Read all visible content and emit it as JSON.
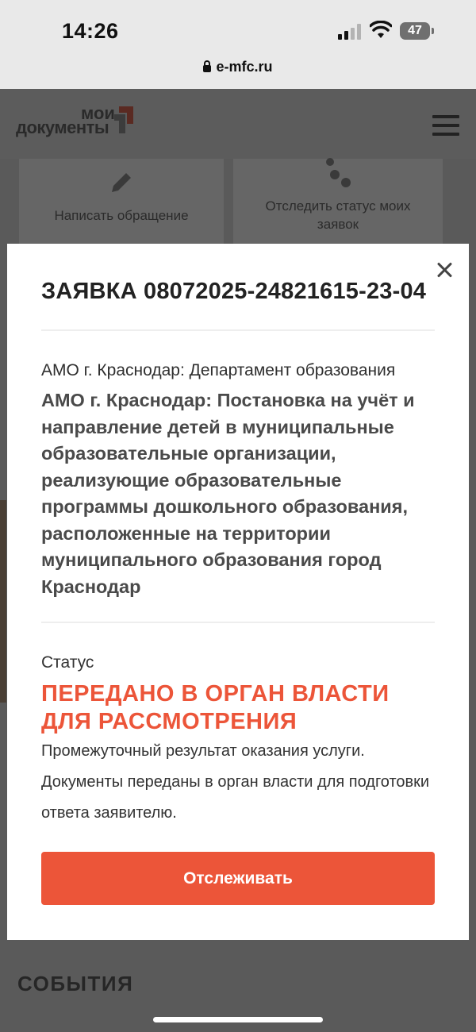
{
  "status_bar": {
    "time": "14:26",
    "battery": "47"
  },
  "browser": {
    "url": "e-mfc.ru"
  },
  "header": {
    "logo_top": "мои",
    "logo_bottom": "документы"
  },
  "background_cards": [
    {
      "label": "Написать обращение"
    },
    {
      "label": "Отследить статус моих заявок"
    }
  ],
  "background_section": {
    "events_title": "СОБЫТИЯ"
  },
  "modal": {
    "title": "ЗАЯВКА 08072025-24821615-23-04",
    "department": "АМО г. Краснодар: Департамент образования",
    "service": "АМО г. Краснодар: Постановка на учёт и направление детей в муниципальные образовательные организации, реализующие образовательные программы дошкольного образования, расположенные на территории муниципального образования город Краснодар",
    "status_label": "Статус",
    "status_value": "ПЕРЕДАНО В ОРГАН ВЛАСТИ ДЛЯ РАССМОТРЕНИЯ",
    "status_description": "Промежуточный результат оказания услуги. Документы переданы в орган власти для подготовки ответа заявителю.",
    "track_button": "Отслеживать"
  },
  "colors": {
    "accent": "#ec5539",
    "overlay": "#5a5a5a"
  }
}
